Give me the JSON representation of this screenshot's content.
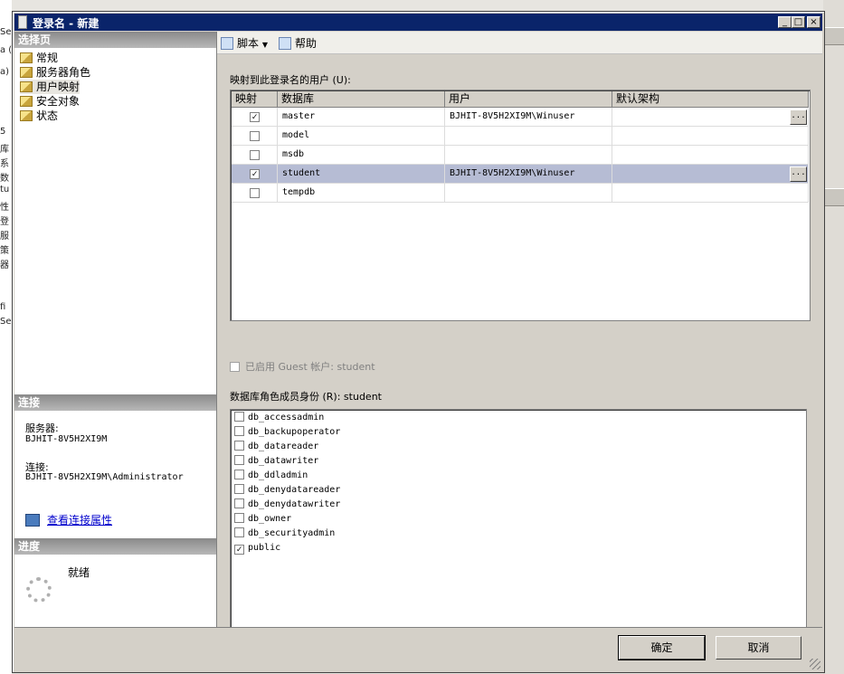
{
  "window": {
    "title": "登录名 - 新建"
  },
  "titlebar_buttons": [
    "_",
    "□",
    "×"
  ],
  "background_fragments": [
    "Se",
    "a (",
    "a)",
    "5",
    "库",
    "系",
    "数",
    "tu",
    "性",
    "登",
    "服",
    "策",
    "器",
    "fi",
    "Se"
  ],
  "left": {
    "select_page_header": "选择页",
    "pages": [
      "常规",
      "服务器角色",
      "用户映射",
      "安全对象",
      "状态"
    ],
    "selected_index": 2,
    "connection_header": "连接",
    "server_label": "服务器:",
    "server_value": "BJHIT-8V5H2XI9M",
    "connection_label": "连接:",
    "connection_value": "BJHIT-8V5H2XI9M\\Administrator",
    "view_connection_link": "查看连接属性",
    "progress_header": "进度",
    "progress_status": "就绪"
  },
  "toolbar": {
    "script_label": "脚本",
    "help_label": "帮助"
  },
  "mapping": {
    "label": "映射到此登录名的用户 (U):",
    "columns": [
      "映射",
      "数据库",
      "用户",
      "默认架构"
    ],
    "rows": [
      {
        "mapped": true,
        "database": "master",
        "user": "BJHIT-8V5H2XI9M\\Winuser",
        "schema": "",
        "ellipsis": "..."
      },
      {
        "mapped": false,
        "database": "model",
        "user": "",
        "schema": "",
        "ellipsis": ""
      },
      {
        "mapped": false,
        "database": "msdb",
        "user": "",
        "schema": "",
        "ellipsis": ""
      },
      {
        "mapped": true,
        "database": "student",
        "user": "BJHIT-8V5H2XI9M\\Winuser",
        "schema": "",
        "ellipsis": "..."
      },
      {
        "mapped": false,
        "database": "tempdb",
        "user": "",
        "schema": "",
        "ellipsis": ""
      }
    ],
    "selected_row": 3
  },
  "guest": {
    "label": "已启用 Guest 帐户: student",
    "checked": false
  },
  "roles": {
    "label": "数据库角色成员身份 (R): student",
    "items": [
      {
        "name": "db_accessadmin",
        "checked": false
      },
      {
        "name": "db_backupoperator",
        "checked": false
      },
      {
        "name": "db_datareader",
        "checked": false
      },
      {
        "name": "db_datawriter",
        "checked": false
      },
      {
        "name": "db_ddladmin",
        "checked": false
      },
      {
        "name": "db_denydatareader",
        "checked": false
      },
      {
        "name": "db_denydatawriter",
        "checked": false
      },
      {
        "name": "db_owner",
        "checked": false
      },
      {
        "name": "db_securityadmin",
        "checked": false
      },
      {
        "name": "public",
        "checked": true
      }
    ]
  },
  "buttons": {
    "ok": "确定",
    "cancel": "取消"
  },
  "colors": {
    "titlebar": "#0a246a",
    "selected_row": "#b6bcd4",
    "link": "#0000cc"
  }
}
